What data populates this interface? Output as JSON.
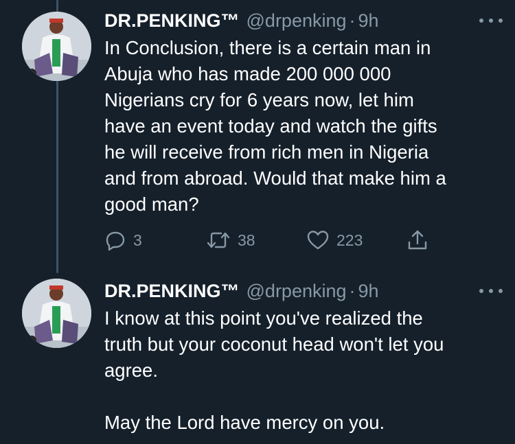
{
  "tweets": [
    {
      "author": "DR.PENKING™",
      "handle": "@drpenking",
      "separator": "·",
      "time": "9h",
      "text": "In Conclusion, there is a certain man in\nAbuja who has made 200 000 000\nNigerians cry for 6 years now, let him\nhave an event today and watch the gifts\nhe will receive from rich men in Nigeria\nand from abroad.  Would that make him a\ngood man?",
      "actions": {
        "replies": "3",
        "retweets": "38",
        "likes": "223"
      }
    },
    {
      "author": "DR.PENKING™",
      "handle": "@drpenking",
      "separator": "·",
      "time": "9h",
      "text": "I know at this point you've realized the\ntruth but your coconut head won't let you\nagree.\n\nMay the Lord have mercy on you."
    }
  ],
  "icons": {
    "reply": "reply-icon",
    "retweet": "retweet-icon",
    "like": "heart-icon",
    "share": "share-icon",
    "more": "more-icon"
  },
  "colors": {
    "background": "#15202b",
    "text": "#ffffff",
    "secondary": "#8899a6",
    "thread_line": "#3d5466"
  }
}
